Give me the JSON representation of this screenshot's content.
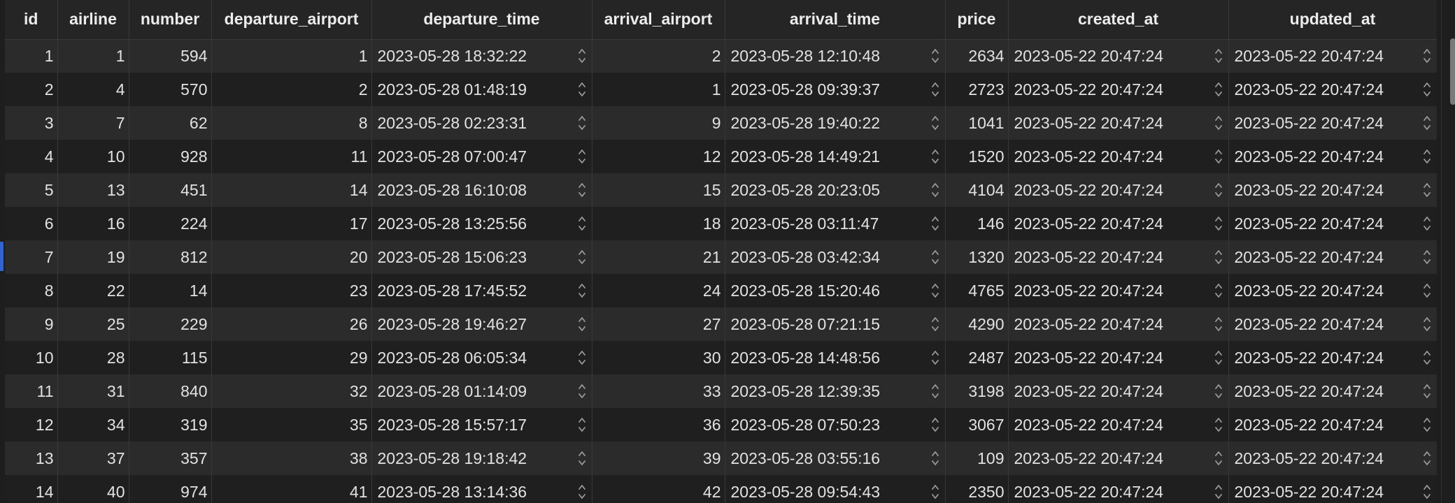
{
  "columns": [
    "id",
    "airline",
    "number",
    "departure_airport",
    "departure_time",
    "arrival_airport",
    "arrival_time",
    "price",
    "created_at",
    "updated_at"
  ],
  "rows": [
    [
      "1",
      "1",
      "594",
      "1",
      "2023-05-28 18:32:22",
      "2",
      "2023-05-28 12:10:48",
      "2634",
      "2023-05-22 20:47:24",
      "2023-05-22 20:47:24"
    ],
    [
      "2",
      "4",
      "570",
      "2",
      "2023-05-28 01:48:19",
      "1",
      "2023-05-28 09:39:37",
      "2723",
      "2023-05-22 20:47:24",
      "2023-05-22 20:47:24"
    ],
    [
      "3",
      "7",
      "62",
      "8",
      "2023-05-28 02:23:31",
      "9",
      "2023-05-28 19:40:22",
      "1041",
      "2023-05-22 20:47:24",
      "2023-05-22 20:47:24"
    ],
    [
      "4",
      "10",
      "928",
      "11",
      "2023-05-28 07:00:47",
      "12",
      "2023-05-28 14:49:21",
      "1520",
      "2023-05-22 20:47:24",
      "2023-05-22 20:47:24"
    ],
    [
      "5",
      "13",
      "451",
      "14",
      "2023-05-28 16:10:08",
      "15",
      "2023-05-28 20:23:05",
      "4104",
      "2023-05-22 20:47:24",
      "2023-05-22 20:47:24"
    ],
    [
      "6",
      "16",
      "224",
      "17",
      "2023-05-28 13:25:56",
      "18",
      "2023-05-28 03:11:47",
      "146",
      "2023-05-22 20:47:24",
      "2023-05-22 20:47:24"
    ],
    [
      "7",
      "19",
      "812",
      "20",
      "2023-05-28 15:06:23",
      "21",
      "2023-05-28 03:42:34",
      "1320",
      "2023-05-22 20:47:24",
      "2023-05-22 20:47:24"
    ],
    [
      "8",
      "22",
      "14",
      "23",
      "2023-05-28 17:45:52",
      "24",
      "2023-05-28 15:20:46",
      "4765",
      "2023-05-22 20:47:24",
      "2023-05-22 20:47:24"
    ],
    [
      "9",
      "25",
      "229",
      "26",
      "2023-05-28 19:46:27",
      "27",
      "2023-05-28 07:21:15",
      "4290",
      "2023-05-22 20:47:24",
      "2023-05-22 20:47:24"
    ],
    [
      "10",
      "28",
      "115",
      "29",
      "2023-05-28 06:05:34",
      "30",
      "2023-05-28 14:48:56",
      "2487",
      "2023-05-22 20:47:24",
      "2023-05-22 20:47:24"
    ],
    [
      "11",
      "31",
      "840",
      "32",
      "2023-05-28 01:14:09",
      "33",
      "2023-05-28 12:39:35",
      "3198",
      "2023-05-22 20:47:24",
      "2023-05-22 20:47:24"
    ],
    [
      "12",
      "34",
      "319",
      "35",
      "2023-05-28 15:57:17",
      "36",
      "2023-05-28 07:50:23",
      "3067",
      "2023-05-22 20:47:24",
      "2023-05-22 20:47:24"
    ],
    [
      "13",
      "37",
      "357",
      "38",
      "2023-05-28 19:18:42",
      "39",
      "2023-05-28 03:55:16",
      "109",
      "2023-05-22 20:47:24",
      "2023-05-22 20:47:24"
    ],
    [
      "14",
      "40",
      "974",
      "41",
      "2023-05-28 13:14:36",
      "42",
      "2023-05-28 09:54:43",
      "2350",
      "2023-05-22 20:47:24",
      "2023-05-22 20:47:24"
    ]
  ],
  "icons": {
    "stepper": "up-down-chevron-icon"
  },
  "colors": {
    "row_marker": "#2f64d6",
    "background": "#1e1e1e"
  }
}
